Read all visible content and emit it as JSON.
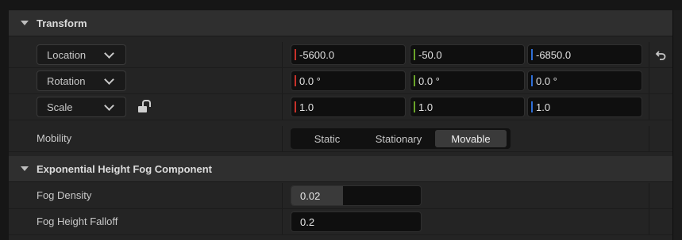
{
  "sections": {
    "transform": "Transform",
    "fog": "Exponential Height Fog Component"
  },
  "transform": {
    "location": {
      "label": "Location",
      "x": "-5600.0",
      "y": "-50.0",
      "z": "-6850.0"
    },
    "rotation": {
      "label": "Rotation",
      "x": "0.0 °",
      "y": "0.0 °",
      "z": "0.0 °"
    },
    "scale": {
      "label": "Scale",
      "x": "1.0",
      "y": "1.0",
      "z": "1.0"
    },
    "mobility": {
      "label": "Mobility",
      "options": [
        "Static",
        "Stationary",
        "Movable"
      ],
      "selected": "Movable"
    }
  },
  "fog": {
    "density": {
      "label": "Fog Density",
      "value": "0.02",
      "slider_fraction": 0.4
    },
    "falloff": {
      "label": "Fog Height Falloff",
      "value": "0.2",
      "slider_fraction": 0.0
    }
  },
  "colors": {
    "axis_x": "#c8312a",
    "axis_y": "#6aa52a",
    "axis_z": "#2f6fd8",
    "reset_arrow": "#c8c8c8"
  },
  "icons": {
    "section_toggle": "triangle-down-icon",
    "dropdown": "chevron-down-icon",
    "lock": "unlocked-padlock-icon",
    "reset": "reset-arrow-icon"
  }
}
